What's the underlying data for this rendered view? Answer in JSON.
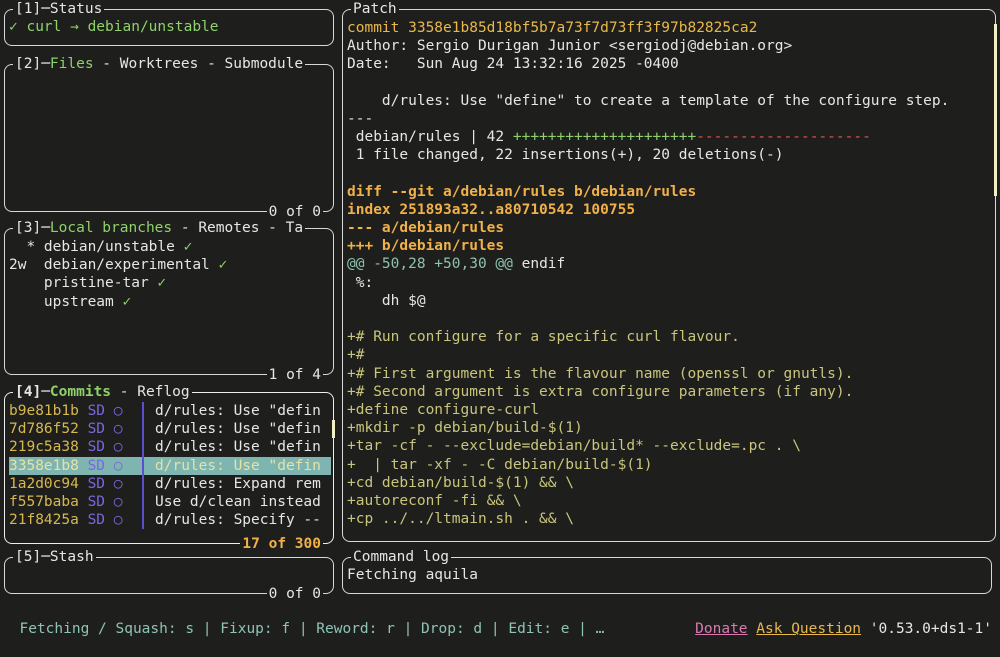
{
  "status": {
    "title": "[1]─Status",
    "content": "✓ curl → debian/unstable"
  },
  "files": {
    "title_num": "[2]─",
    "tab_active": "Files",
    "tab_rest": " - Worktrees - Submodule",
    "footer": "0 of 0"
  },
  "branches": {
    "title_num": "[3]─",
    "tab_active": "Local branches",
    "tab_rest": " - Remotes - Ta",
    "items": [
      {
        "prefix": "  * ",
        "name": "debian/unstable",
        "check": " ✓"
      },
      {
        "prefix": "2w  ",
        "name": "debian/experimental",
        "check": " ✓"
      },
      {
        "prefix": "    ",
        "name": "pristine-tar",
        "check": " ✓"
      },
      {
        "prefix": "    ",
        "name": "upstream",
        "check": " ✓"
      }
    ],
    "footer": "1 of 4"
  },
  "commits": {
    "title_num": "[4]─",
    "tab_active": "Commits",
    "tab_rest": " - Reflog",
    "items": [
      {
        "hash": "b9e81b1b",
        "author": "SD",
        "graph": "○",
        "msg": "d/rules: Use \"defin"
      },
      {
        "hash": "7d786f52",
        "author": "SD",
        "graph": "○",
        "msg": "d/rules: Use \"defin"
      },
      {
        "hash": "219c5a38",
        "author": "SD",
        "graph": "○",
        "msg": "d/rules: Use \"defin"
      },
      {
        "hash": "3358e1b8",
        "author": "SD",
        "graph": "○",
        "msg": "d/rules: Use \"defin"
      },
      {
        "hash": "1a2d0c94",
        "author": "SD",
        "graph": "○",
        "msg": "d/rules: Expand rem"
      },
      {
        "hash": "f557baba",
        "author": "SD",
        "graph": "○",
        "msg": "Use d/clean instead"
      },
      {
        "hash": "21f8425a",
        "author": "SD",
        "graph": "○",
        "msg": "d/rules: Specify --"
      }
    ],
    "selected_index": 3,
    "footer": "17 of 300"
  },
  "stash": {
    "title": "[5]─Stash",
    "footer": "0 of 0"
  },
  "patch": {
    "title": "Patch",
    "lines": [
      {
        "text": "commit 3358e1b85d18bf5b7a73f7d73ff3f97b82825ca2",
        "style": "yellow"
      },
      {
        "text": "Author: Sergio Durigan Junior <sergiodj@debian.org>",
        "style": ""
      },
      {
        "text": "Date:   Sun Aug 24 13:32:16 2025 -0400",
        "style": ""
      },
      {
        "text": "",
        "style": ""
      },
      {
        "text": "    d/rules: Use \"define\" to create a template of the configure step.",
        "style": ""
      },
      {
        "text": "---",
        "style": ""
      },
      {
        "text": " debian/rules | 42 ",
        "style": "",
        "plus": "+++++++++++++++++++++",
        "minus": "--------------------"
      },
      {
        "text": " 1 file changed, 22 insertions(+), 20 deletions(-)",
        "style": ""
      },
      {
        "text": "",
        "style": ""
      },
      {
        "text": "diff --git a/debian/rules b/debian/rules",
        "style": "boldy"
      },
      {
        "text": "index 251893a32..a80710542 100755",
        "style": "boldy"
      },
      {
        "text": "--- a/debian/rules",
        "style": "boldy"
      },
      {
        "text": "+++ b/debian/rules",
        "style": "boldy"
      },
      {
        "text": "@@ -50,28 +50,30 @@",
        "style": "hunk",
        "suffix": " endif"
      },
      {
        "text": " %:",
        "style": ""
      },
      {
        "text": "    dh $@",
        "style": ""
      },
      {
        "text": "",
        "style": ""
      },
      {
        "text": "+# Run configure for a specific curl flavour.",
        "style": "addl"
      },
      {
        "text": "+#",
        "style": "addl"
      },
      {
        "text": "+# First argument is the flavour name (openssl or gnutls).",
        "style": "addl"
      },
      {
        "text": "+# Second argument is extra configure parameters (if any).",
        "style": "addl"
      },
      {
        "text": "+define configure-curl",
        "style": "addl"
      },
      {
        "text": "+mkdir -p debian/build-$(1)",
        "style": "addl"
      },
      {
        "text": "+tar -cf - --exclude=debian/build* --exclude=.pc . \\",
        "style": "addl"
      },
      {
        "text": "+  | tar -xf - -C debian/build-$(1)",
        "style": "addl"
      },
      {
        "text": "+cd debian/build-$(1) && \\",
        "style": "addl"
      },
      {
        "text": "+autoreconf -fi && \\",
        "style": "addl"
      },
      {
        "text": "+cp ../../ltmain.sh . && \\",
        "style": "addl"
      }
    ]
  },
  "command_log": {
    "title": "Command log",
    "text": "Fetching aquila"
  },
  "bottom_bar": {
    "left": "Fetching / Squash: s | Fixup: f | Reword: r | Drop: d | Edit: e | …",
    "donate": "Donate",
    "ask": "Ask Question",
    "version": "'0.53.0+ds1-1'"
  }
}
